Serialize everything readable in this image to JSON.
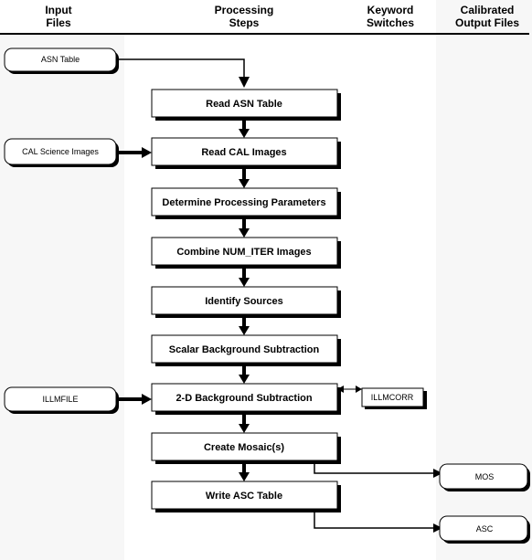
{
  "headers": [
    {
      "line1": "Input",
      "line2": "Files"
    },
    {
      "line1": "Processing",
      "line2": "Steps"
    },
    {
      "line1": "Keyword",
      "line2": "Switches"
    },
    {
      "line1": "Calibrated",
      "line2": "Output Files"
    }
  ],
  "inputs": [
    "ASN Table",
    "CAL Science Images",
    "ILLMFILE"
  ],
  "steps": [
    "Read ASN Table",
    "Read CAL Images",
    "Determine Processing Parameters",
    "Combine NUM_ITER Images",
    "Identify Sources",
    "Scalar Background Subtraction",
    "2-D Background Subtraction",
    "Create Mosaic(s)",
    "Write ASC Table"
  ],
  "switches": [
    "ILLMCORR"
  ],
  "outputs": [
    "MOS",
    "ASC"
  ],
  "colors": {
    "column_shade": "#f7f7f7",
    "ink": "#000000"
  }
}
